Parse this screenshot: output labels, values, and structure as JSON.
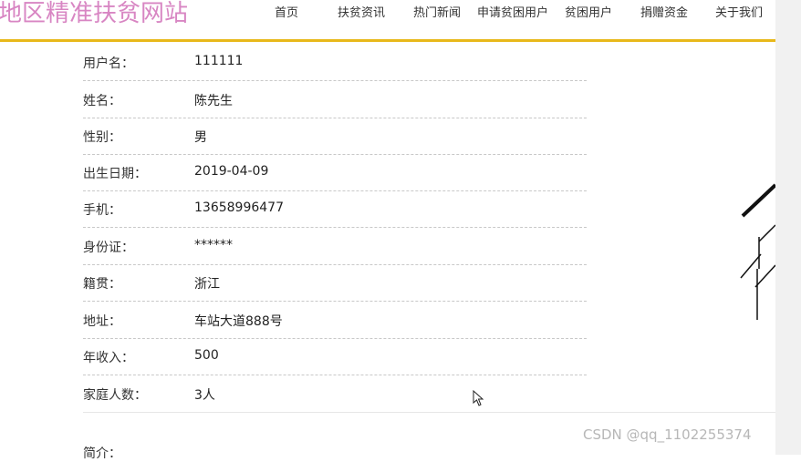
{
  "header": {
    "site_title": "地区精准扶贫网站",
    "nav": [
      {
        "label": "首页"
      },
      {
        "label": "扶贫资讯"
      },
      {
        "label": "热门新闻"
      },
      {
        "label": "申请贫困用户"
      },
      {
        "label": "贫困用户"
      },
      {
        "label": "捐赠资金"
      },
      {
        "label": "关于我们"
      }
    ],
    "accent_color": "#e8b81a",
    "title_color": "#d886c3"
  },
  "profile": {
    "fields": [
      {
        "label": "用户名：",
        "value": "111111"
      },
      {
        "label": "姓名：",
        "value": "陈先生"
      },
      {
        "label": "性别：",
        "value": "男"
      },
      {
        "label": "出生日期：",
        "value": "2019-04-09"
      },
      {
        "label": "手机：",
        "value": "13658996477"
      },
      {
        "label": "身份证：",
        "value": "******"
      },
      {
        "label": "籍贯：",
        "value": "浙江"
      },
      {
        "label": "地址：",
        "value": "车站大道888号"
      },
      {
        "label": "年收入：",
        "value": "500"
      },
      {
        "label": "家庭人数：",
        "value": "3人"
      }
    ],
    "intro_label": "简介："
  },
  "watermark": "CSDN @qq_1102255374"
}
